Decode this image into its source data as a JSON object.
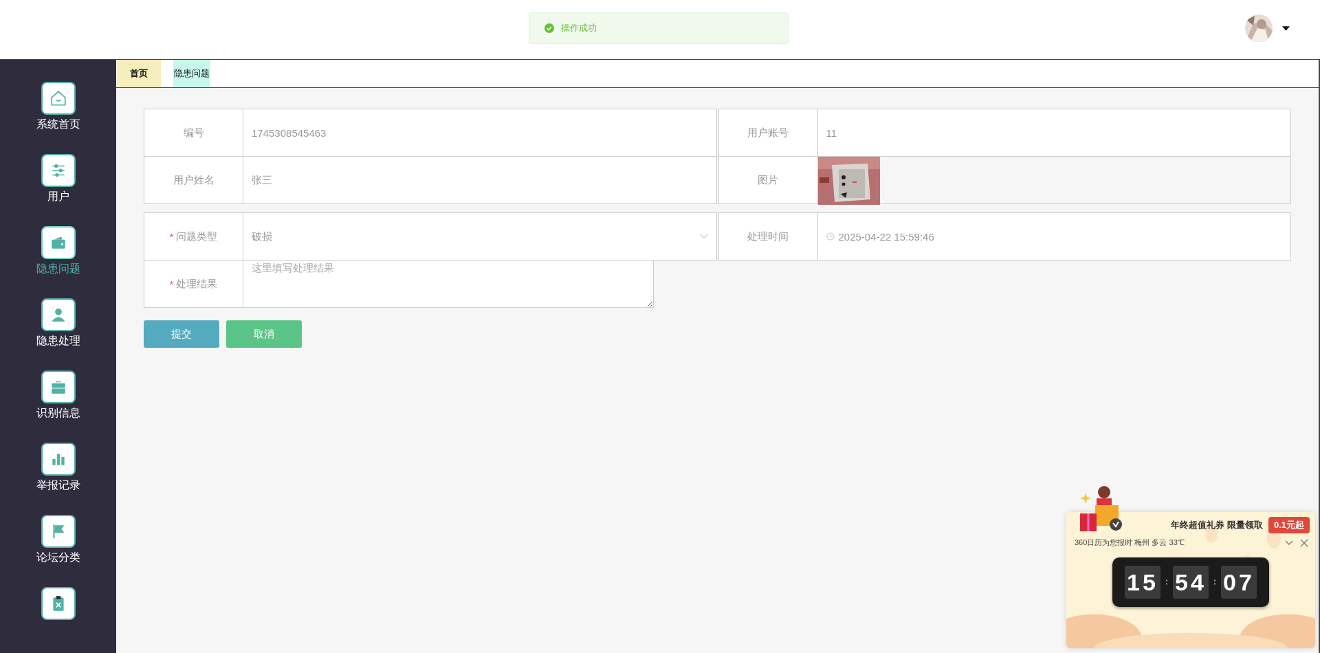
{
  "header": {
    "toast": "操作成功"
  },
  "sidebar": {
    "items": [
      {
        "label": "系统首页",
        "selected": false
      },
      {
        "label": "用户",
        "selected": false
      },
      {
        "label": "隐患问题",
        "selected": true
      },
      {
        "label": "隐患处理",
        "selected": false
      },
      {
        "label": "识别信息",
        "selected": false
      },
      {
        "label": "举报记录",
        "selected": false
      },
      {
        "label": "论坛分类",
        "selected": false
      },
      {
        "selected": false
      }
    ]
  },
  "tabs": [
    {
      "label": "首页",
      "color": "#f7eebd"
    },
    {
      "label": "隐患问题",
      "color": "#c8f8ec"
    }
  ],
  "form": {
    "groups": [
      [
        [
          {
            "label": "编号",
            "kind": "text",
            "value": "1745308545463"
          },
          {
            "label": "用户账号",
            "kind": "text",
            "value": "11"
          }
        ],
        [
          {
            "label": "用户姓名",
            "kind": "text",
            "value": "张三"
          },
          {
            "label": "图片"
          }
        ]
      ],
      [
        [
          {
            "label": "问题类型",
            "kind": "select",
            "marker": "*",
            "value": "破损"
          },
          {
            "label": "处理时间",
            "kind": "datetime",
            "value": "2025-04-22 15:59:46"
          }
        ],
        [
          {
            "label": "处理结果",
            "kind": "textarea",
            "marker": "*",
            "placeholder": "这里填写处理结果"
          }
        ]
      ]
    ],
    "buttons": [
      {
        "label": "提交",
        "kind": "primary"
      },
      {
        "label": "取消",
        "kind": "cancel"
      }
    ]
  },
  "popup": {
    "title": "年终超值礼券 限量领取",
    "badge": "0.1元起",
    "info": "360日历为您报时 梅州 多云 33℃",
    "clock": [
      "15",
      "54",
      "07"
    ]
  }
}
